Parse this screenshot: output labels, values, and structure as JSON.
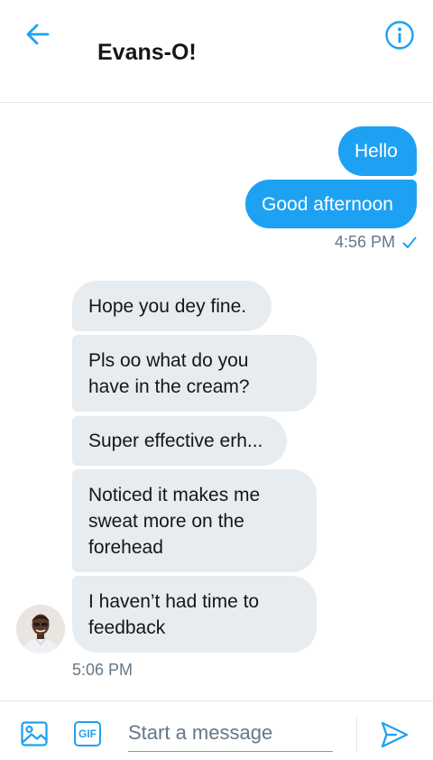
{
  "header": {
    "title": "Evans-O!",
    "back_icon": "arrow-left-icon",
    "info_icon": "info-icon"
  },
  "colors": {
    "accent": "#1da1f2",
    "incoming_bubble": "#e6ecf0",
    "text": "#14171a",
    "muted": "#657786"
  },
  "outgoing": {
    "messages": [
      "Hello",
      "Good afternoon"
    ],
    "timestamp": "4:56 PM",
    "status_icon": "check-icon"
  },
  "incoming": {
    "messages": [
      "Hope you dey fine.",
      "Pls oo what do you\nhave in the cream?",
      "Super effective erh...",
      "Noticed it makes me\nsweat more on the\nforehead",
      "I haven’t had time to\nfeedback"
    ],
    "timestamp": "5:06 PM"
  },
  "composer": {
    "placeholder": "Start a message",
    "gif_label": "GIF",
    "image_icon": "image-icon",
    "send_icon": "send-icon"
  }
}
